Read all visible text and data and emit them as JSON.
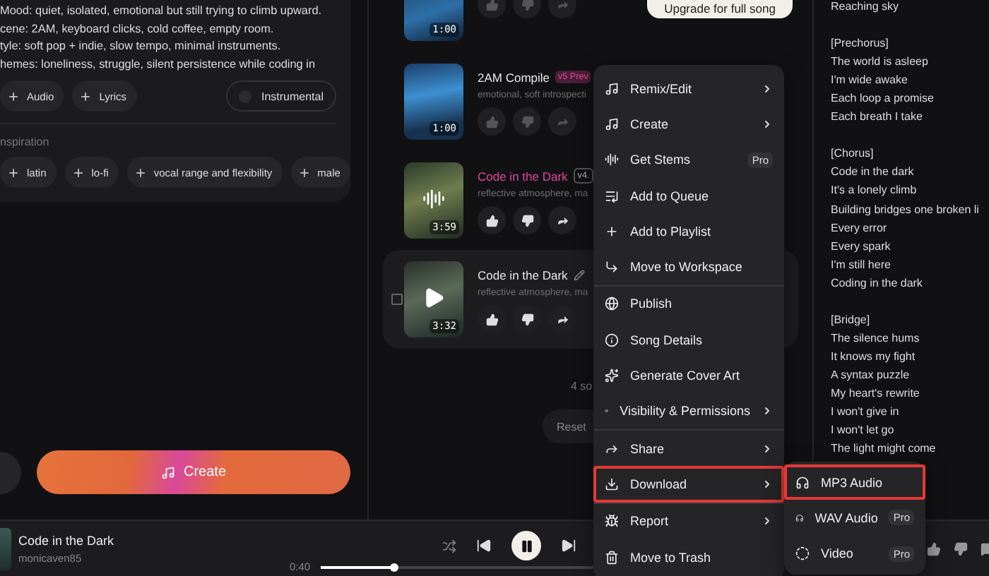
{
  "prompt_lines": [
    "Mood: quiet, isolated, emotional but still trying to climb upward.",
    "cene: 2AM, keyboard clicks, cold coffee, empty room.",
    "tyle: soft  pop + indie, slow tempo, minimal instruments.",
    "hemes: loneliness, struggle, silent persistence while coding in"
  ],
  "add_chips": [
    "Audio",
    "Lyrics"
  ],
  "instrumental": {
    "label": "Instrumental",
    "on": false
  },
  "inspiration": {
    "label": "nspiration",
    "chips": [
      "latin",
      "lo-fi",
      "vocal range and flexibility",
      "male"
    ]
  },
  "create_button": "Create",
  "upgrade_button": "Upgrade for full song",
  "songs": [
    {
      "duration": "1:00",
      "playing": false,
      "selected": false
    },
    {
      "title": "2AM Compile",
      "tag": {
        "kind": "preview",
        "text": "v5 Prev"
      },
      "subtitle": "emotional, soft introspecti",
      "duration": "1:00",
      "playing": false,
      "selected": false
    },
    {
      "title": "Code in the Dark",
      "tag": {
        "kind": "version",
        "text": "v4."
      },
      "subtitle": "reflective atmosphere, ma",
      "duration": "3:59",
      "playing": true,
      "selected": false
    },
    {
      "title": "Code in the Dark",
      "subtitle": "reflective atmosphere, ma",
      "duration": "3:32",
      "playing": false,
      "selected": true
    }
  ],
  "song_count": "4 so",
  "reset_button": "Reset",
  "menu": {
    "groups": [
      [
        {
          "label": "Remix/Edit",
          "submenu": true,
          "highlighted": false
        },
        {
          "label": "Create",
          "submenu": true,
          "highlighted": false
        },
        {
          "label": "Get Stems",
          "badge": "Pro",
          "submenu": false,
          "highlighted": false
        },
        {
          "label": "Add to Queue",
          "submenu": false,
          "highlighted": false
        },
        {
          "label": "Add to Playlist",
          "submenu": false,
          "highlighted": false
        },
        {
          "label": "Move to Workspace",
          "submenu": false,
          "highlighted": false
        }
      ],
      [
        {
          "label": "Publish",
          "submenu": false,
          "highlighted": false
        },
        {
          "label": "Song Details",
          "submenu": false,
          "highlighted": false
        },
        {
          "label": "Generate Cover Art",
          "submenu": false,
          "highlighted": false
        },
        {
          "label": "Visibility & Permissions",
          "submenu": true,
          "highlighted": false
        }
      ],
      [
        {
          "label": "Share",
          "submenu": true,
          "highlighted": false
        },
        {
          "label": "Download",
          "submenu": true,
          "highlighted": true
        }
      ],
      [
        {
          "label": "Report",
          "submenu": true,
          "highlighted": false
        },
        {
          "label": "Move to Trash",
          "submenu": false,
          "highlighted": false
        }
      ]
    ]
  },
  "download_submenu": [
    {
      "label": "MP3 Audio",
      "highlighted": true
    },
    {
      "label": "WAV Audio",
      "badge": "Pro",
      "highlighted": false
    },
    {
      "label": "Video",
      "badge": "Pro",
      "highlighted": false
    }
  ],
  "lyrics": [
    {
      "lines": [
        "Reaching sky"
      ]
    },
    {
      "heading": "[Prechorus]",
      "lines": [
        "The world is asleep",
        "I'm wide awake",
        "Each loop a promise",
        "Each breath I take"
      ]
    },
    {
      "heading": "[Chorus]",
      "lines": [
        "Code in the dark",
        "It's a lonely climb",
        "Building bridges one broken li",
        "Every error",
        "Every spark",
        "I'm still here",
        "Coding in the dark"
      ]
    },
    {
      "heading": "[Bridge]",
      "lines": [
        "The silence hums",
        "It knows my fight",
        "A syntax puzzle",
        "My heart's rewrite",
        "I won't give in",
        "I won't let go",
        "The light might come"
      ]
    }
  ],
  "player": {
    "title": "Code in the Dark",
    "artist": "monicaven85",
    "elapsed": "0:40",
    "level": 0.18
  }
}
